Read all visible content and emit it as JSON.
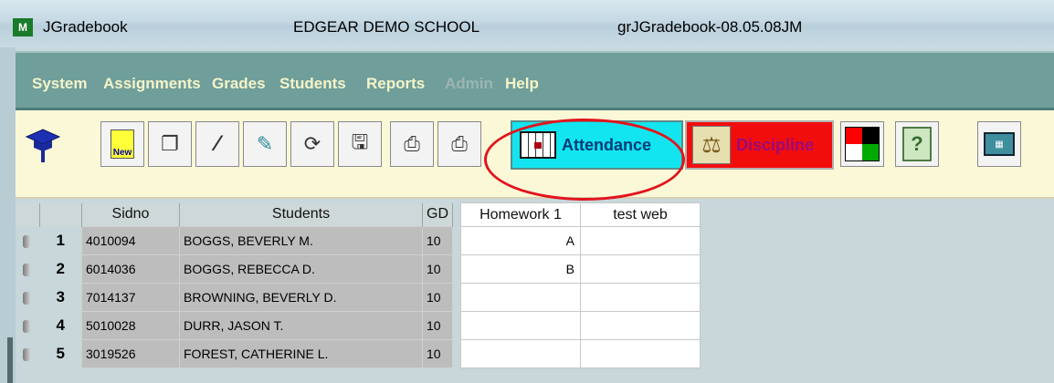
{
  "window": {
    "app_title": "JGradebook",
    "school": "EDGEAR DEMO SCHOOL",
    "version": "grJGradebook-08.05.08JM",
    "logo_text": "M"
  },
  "menu": [
    "System",
    "Assignments",
    "Grades",
    "Students",
    "Reports",
    "Admin",
    "Help"
  ],
  "toolbar": {
    "new_label": "New",
    "attendance_label": "Attendance",
    "discipline_label": "Discipline",
    "discipline_icon_text": "DISCIPLINE",
    "help_glyph": "?",
    "icons": [
      "graduation-cap-icon",
      "new-icon",
      "copy-icon",
      "percent-icon",
      "eraser-icon",
      "refresh-icon",
      "save-icon",
      "print-icon",
      "attendance-grid-icon",
      "discipline-scale-icon",
      "color-quad-icon",
      "help-icon",
      "calculator-icon"
    ],
    "colors": {
      "attendance_bg": "#12e5ef",
      "discipline_bg": "#f20d0d",
      "highlight_ellipse": "#e3141c"
    }
  },
  "grid": {
    "headers": {
      "sidno": "Sidno",
      "students": "Students",
      "gd": "GD",
      "homework1": "Homework 1",
      "test_web": "test web"
    },
    "rows": [
      {
        "num": "1",
        "sidno": "4010094",
        "name": "BOGGS, BEVERLY M.",
        "gd": "10",
        "homework1": "A",
        "test_web": ""
      },
      {
        "num": "2",
        "sidno": "6014036",
        "name": "BOGGS, REBECCA D.",
        "gd": "10",
        "homework1": "B",
        "test_web": ""
      },
      {
        "num": "3",
        "sidno": "7014137",
        "name": "BROWNING, BEVERLY D.",
        "gd": "10",
        "homework1": "",
        "test_web": ""
      },
      {
        "num": "4",
        "sidno": "5010028",
        "name": "DURR, JASON T.",
        "gd": "10",
        "homework1": "",
        "test_web": ""
      },
      {
        "num": "5",
        "sidno": "3019526",
        "name": "FOREST, CATHERINE L.",
        "gd": "10",
        "homework1": "",
        "test_web": ""
      }
    ]
  }
}
